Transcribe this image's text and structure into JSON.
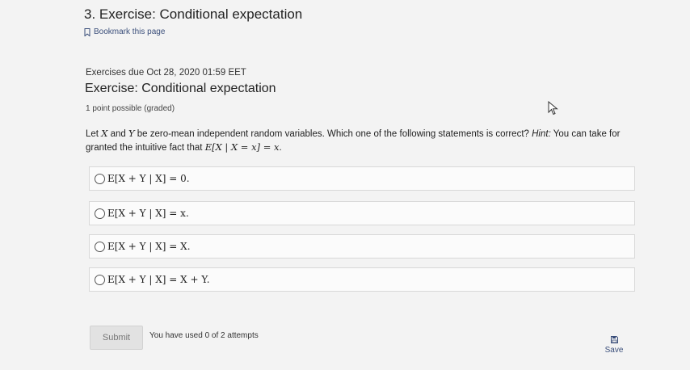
{
  "page": {
    "title": "3. Exercise: Conditional expectation",
    "bookmark_label": "Bookmark this page"
  },
  "problem": {
    "due": "Exercises due Oct 28, 2020 01:59 EET",
    "title": "Exercise: Conditional expectation",
    "points": "1 point possible (graded)",
    "question_parts": {
      "p1": "Let ",
      "X": "X",
      "p2": " and ",
      "Y": "Y",
      "p3": " be zero-mean independent random variables. Which one of the following statements is correct? ",
      "hint_label": "Hint:",
      "p4": " You can take for granted the intuitive fact that ",
      "hint_math": "E[X | X = x] = x",
      "p5": "."
    }
  },
  "options": [
    {
      "text": "E[X + Y | X] = 0."
    },
    {
      "text": "E[X + Y | X] = x."
    },
    {
      "text": "E[X + Y | X] = X."
    },
    {
      "text": "E[X + Y | X] = X + Y."
    }
  ],
  "actions": {
    "submit_label": "Submit",
    "attempts_text": "You have used 0 of 2 attempts",
    "save_label": "Save"
  },
  "icons": {
    "bookmark": "bookmark-icon",
    "save": "floppy-disk-icon",
    "cursor": "mouse-pointer-icon"
  },
  "colors": {
    "link": "#3a4e7a",
    "background": "#f3f3f3",
    "option_bg": "#fbfbfb",
    "submit_bg": "#e2e2e2"
  }
}
